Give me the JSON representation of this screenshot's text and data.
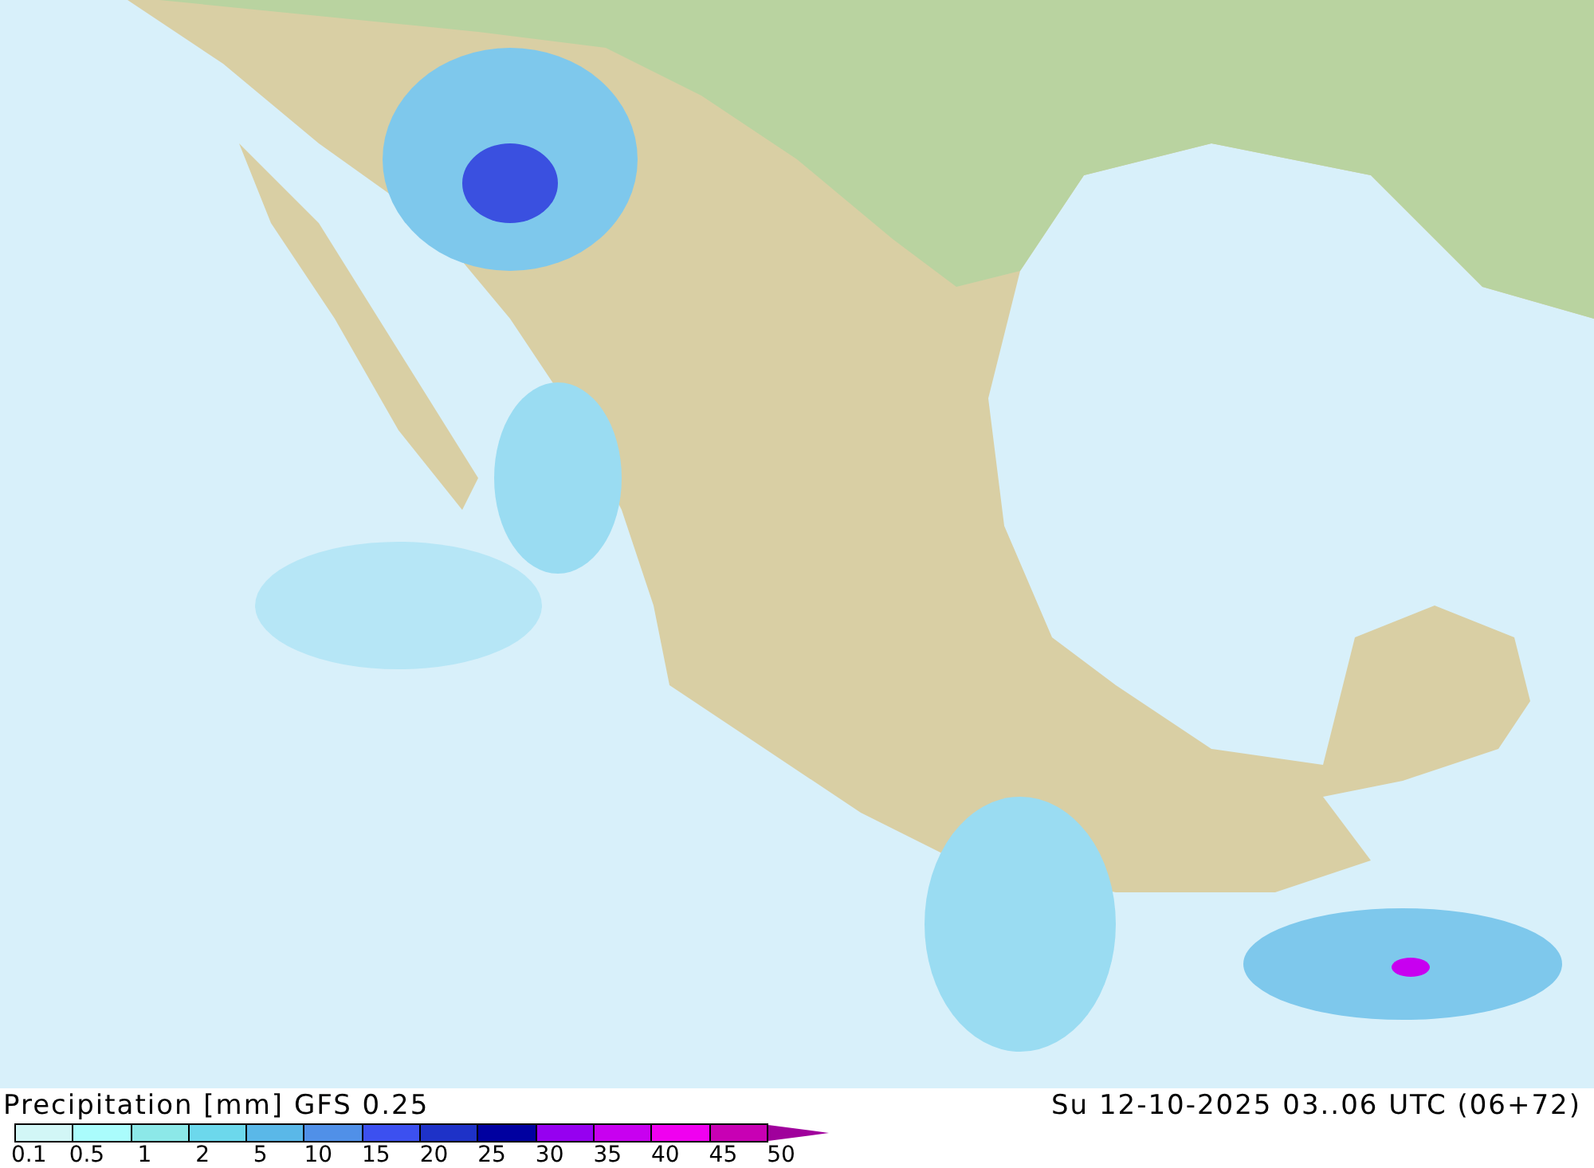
{
  "footer": {
    "title": "Precipitation [mm] GFS 0.25",
    "valid_time": "Su 12-10-2025 03..06 UTC (06+72)"
  },
  "legend": {
    "segments": [
      {
        "color": "#d2f6f6"
      },
      {
        "color": "#aafcfc"
      },
      {
        "color": "#8ce8e8"
      },
      {
        "color": "#6cd8ec"
      },
      {
        "color": "#5ab8e8"
      },
      {
        "color": "#5090e8"
      },
      {
        "color": "#3c50f0"
      },
      {
        "color": "#1e32c8"
      },
      {
        "color": "#0000a0"
      },
      {
        "color": "#9600f0"
      },
      {
        "color": "#c800f0"
      },
      {
        "color": "#f000f0"
      },
      {
        "color": "#c800b4"
      }
    ],
    "labels": [
      "0.1",
      "0.5",
      "1",
      "2",
      "5",
      "10",
      "15",
      "20",
      "25",
      "30",
      "35",
      "40",
      "45",
      "50"
    ]
  }
}
